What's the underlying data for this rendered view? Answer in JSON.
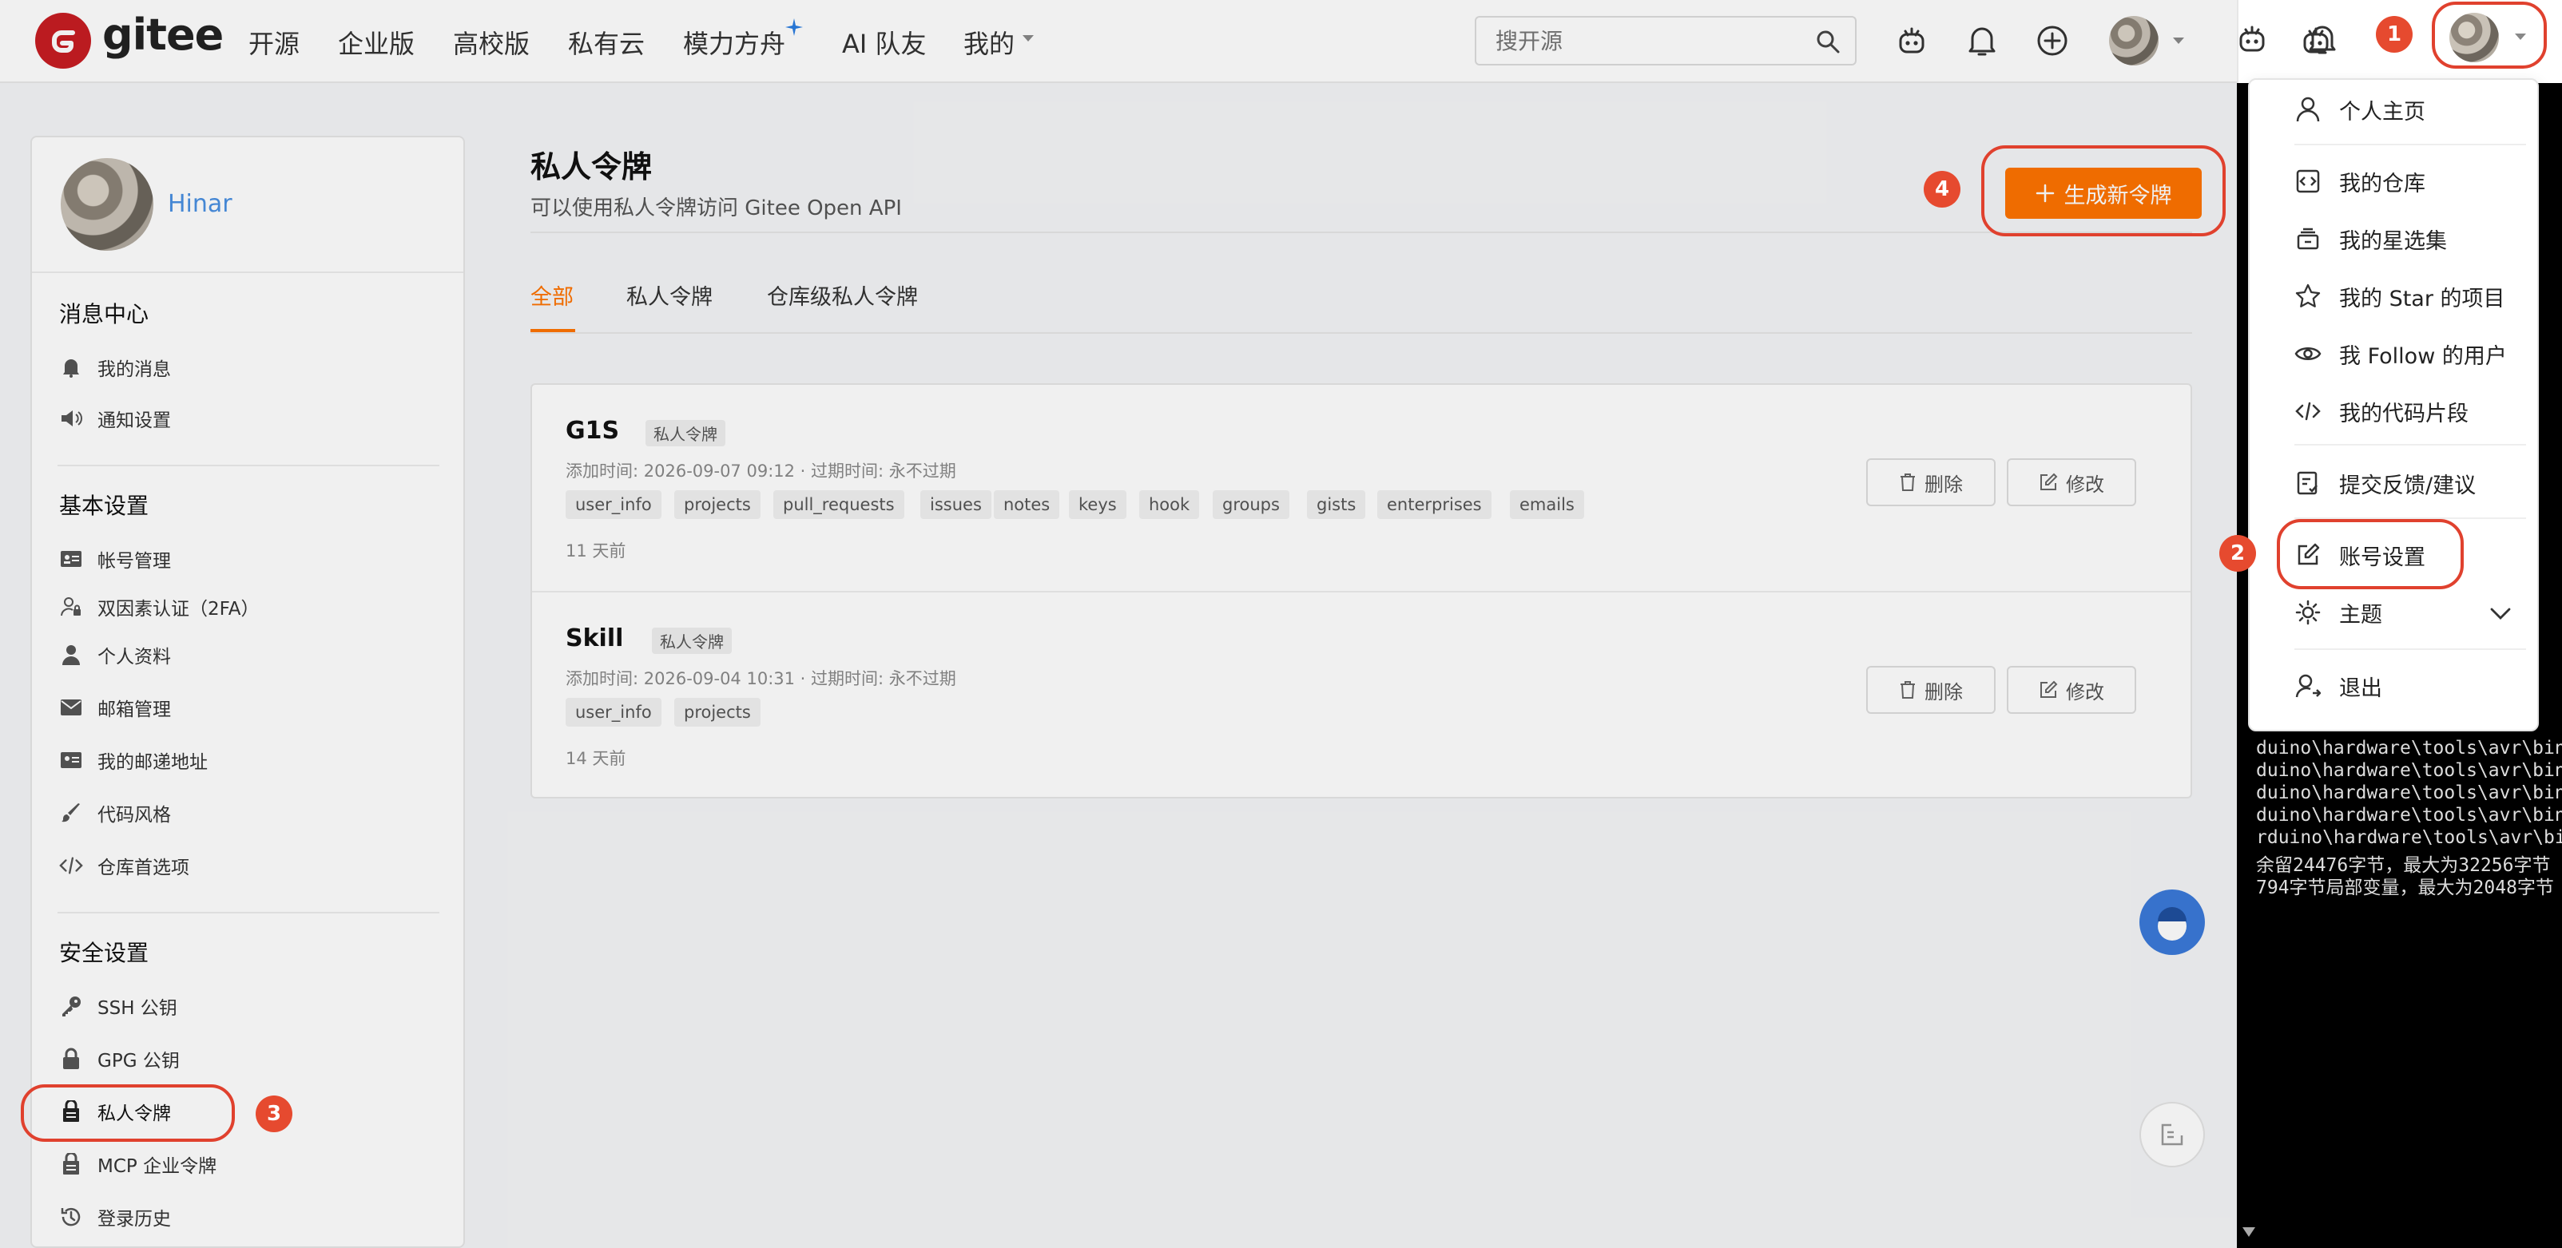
{
  "brand": {
    "name": "gitee",
    "color": "#c71d23",
    "accent": "#fe7300"
  },
  "nav": {
    "items": [
      "开源",
      "企业版",
      "高校版",
      "私有云",
      "模力方舟",
      "AI 队友",
      "我的"
    ],
    "search_placeholder": "搜开源"
  },
  "sidebar": {
    "username": "Hinar",
    "groups": [
      {
        "title": "消息中心",
        "items": [
          "我的消息",
          "通知设置"
        ]
      },
      {
        "title": "基本设置",
        "items": [
          "帐号管理",
          "双因素认证（2FA）",
          "个人资料",
          "邮箱管理",
          "我的邮递地址",
          "代码风格",
          "仓库首选项"
        ]
      },
      {
        "title": "安全设置",
        "items": [
          "SSH 公钥",
          "GPG 公钥",
          "私人令牌",
          "MCP 企业令牌",
          "登录历史"
        ]
      }
    ]
  },
  "main": {
    "title": "私人令牌",
    "subtitle": "可以使用私人令牌访问  Gitee Open API",
    "generate_button": "生成新令牌",
    "tabs": [
      "全部",
      "私人令牌",
      "仓库级私人令牌"
    ],
    "tokens": [
      {
        "name": "G1S",
        "badge": "私人令牌",
        "meta": "添加时间: 2026-09-07 09:12  ·  过期时间: 永不过期",
        "scopes": [
          "user_info",
          "projects",
          "pull_requests",
          "issues",
          "notes",
          "keys",
          "hook",
          "groups",
          "gists",
          "enterprises",
          "emails"
        ],
        "age": "11 天前"
      },
      {
        "name": "Skill",
        "badge": "私人令牌",
        "meta": "添加时间: 2026-09-04 10:31  ·  过期时间: 永不过期",
        "scopes": [
          "user_info",
          "projects"
        ],
        "age": "14 天前"
      }
    ],
    "delete_label": "删除",
    "edit_label": "修改"
  },
  "dropdown": {
    "items": [
      "个人主页",
      "我的仓库",
      "我的星选集",
      "我的 Star 的项目",
      "我 Follow 的用户",
      "我的代码片段",
      "提交反馈/建议",
      "账号设置",
      "主题",
      "退出"
    ]
  },
  "terminal": {
    "lines": [
      "duino\\hardware\\tools\\avr\\bin\\",
      "duino\\hardware\\tools\\avr\\bin\\",
      "duino\\hardware\\tools\\avr\\bin\\",
      "duino\\hardware\\tools\\avr\\bin\\",
      "rduino\\hardware\\tools\\avr\\bin",
      "余留24476字节，最大为32256字节",
      "794字节局部变量，最大为2048字节"
    ]
  },
  "steps": [
    "1",
    "2",
    "3",
    "4"
  ]
}
